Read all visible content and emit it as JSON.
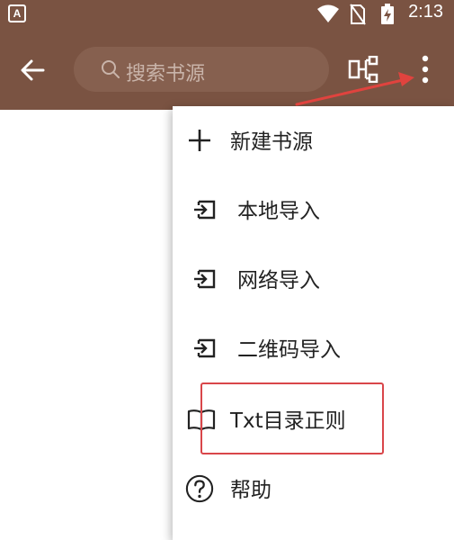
{
  "status_bar": {
    "app_icon_letter": "A",
    "time": "2:13"
  },
  "toolbar": {
    "search_placeholder": "搜索书源",
    "back_icon": "arrow-left-icon",
    "group_icon": "group-icon",
    "more_icon": "more-vert-icon"
  },
  "menu": {
    "items": [
      {
        "label": "新建书源",
        "icon": "plus-icon"
      },
      {
        "label": "本地导入",
        "icon": "import-icon"
      },
      {
        "label": "网络导入",
        "icon": "import-icon"
      },
      {
        "label": "二维码导入",
        "icon": "import-icon"
      },
      {
        "label": "Txt目录正则",
        "icon": "book-icon"
      },
      {
        "label": "帮助",
        "icon": "help-icon"
      }
    ]
  },
  "colors": {
    "primary": "#7a5342",
    "search_bg": "#86604f",
    "annotation_red": "#d9464a"
  }
}
